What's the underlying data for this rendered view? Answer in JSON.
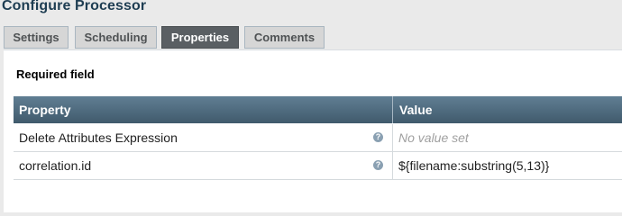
{
  "dialog": {
    "title": "Configure Processor"
  },
  "tabs": [
    {
      "label": "Settings",
      "active": false
    },
    {
      "label": "Scheduling",
      "active": false
    },
    {
      "label": "Properties",
      "active": true
    },
    {
      "label": "Comments",
      "active": false
    }
  ],
  "properties": {
    "required_label": "Required field",
    "headers": {
      "property": "Property",
      "value": "Value"
    },
    "rows": [
      {
        "name": "Delete Attributes Expression",
        "value": "No value set",
        "help": "?"
      },
      {
        "name": "correlation.id",
        "value": "${filename:substring(5,13)}",
        "help": "?"
      }
    ]
  },
  "colors": {
    "header_gradient_top": "#607e93",
    "header_gradient_bottom": "#405a6c",
    "active_tab": "#5a5f63",
    "title": "#1e3d52"
  }
}
